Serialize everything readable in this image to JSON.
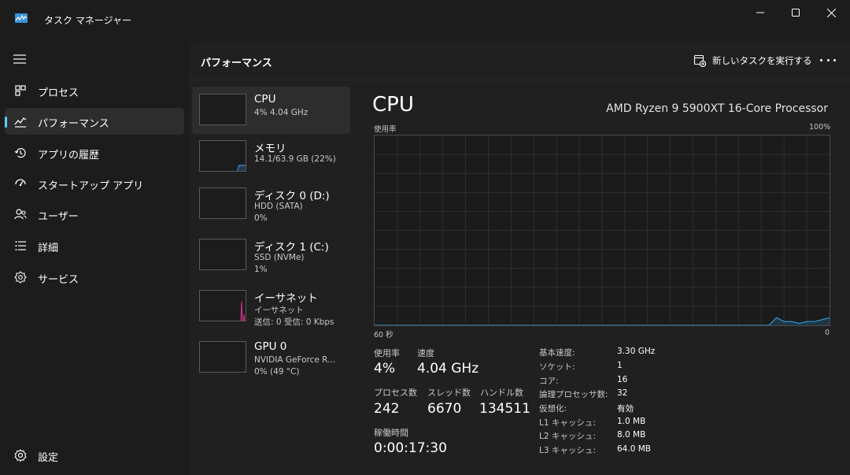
{
  "window": {
    "title": "タスク マネージャー"
  },
  "nav": {
    "items": [
      {
        "label": "プロセス",
        "icon": "processes-icon"
      },
      {
        "label": "パフォーマンス",
        "icon": "performance-icon"
      },
      {
        "label": "アプリの履歴",
        "icon": "history-icon"
      },
      {
        "label": "スタートアップ アプリ",
        "icon": "startup-icon"
      },
      {
        "label": "ユーザー",
        "icon": "users-icon"
      },
      {
        "label": "詳細",
        "icon": "details-icon"
      },
      {
        "label": "サービス",
        "icon": "services-icon"
      }
    ],
    "settings_label": "設定"
  },
  "header": {
    "title": "パフォーマンス",
    "run_task_label": "新しいタスクを実行する"
  },
  "devices": [
    {
      "name": "CPU",
      "sub1": "4%  4.04 GHz",
      "sub2": ""
    },
    {
      "name": "メモリ",
      "sub1": "14.1/63.9 GB (22%)",
      "sub2": ""
    },
    {
      "name": "ディスク 0 (D:)",
      "sub1": "HDD (SATA)",
      "sub2": "0%"
    },
    {
      "name": "ディスク 1 (C:)",
      "sub1": "SSD (NVMe)",
      "sub2": "1%"
    },
    {
      "name": "イーサネット",
      "sub1": "イーサネット",
      "sub2": "送信: 0 受信: 0 Kbps"
    },
    {
      "name": "GPU 0",
      "sub1": "NVIDIA GeForce R...",
      "sub2": "0%  (49 °C)"
    }
  ],
  "detail": {
    "title": "CPU",
    "model": "AMD Ryzen 9 5900XT 16-Core Processor",
    "graph_label_top_left": "使用率",
    "graph_label_top_right": "100%",
    "graph_label_bottom_left": "60 秒",
    "graph_label_bottom_right": "0",
    "stats": {
      "usage_label": "使用率",
      "usage_value": "4%",
      "speed_label": "速度",
      "speed_value": "4.04 GHz",
      "processes_label": "プロセス数",
      "processes_value": "242",
      "threads_label": "スレッド数",
      "threads_value": "6670",
      "handles_label": "ハンドル数",
      "handles_value": "134511",
      "uptime_label": "稼働時間",
      "uptime_value": "0:00:17:30"
    },
    "specs": [
      {
        "k": "基本速度:",
        "v": "3.30 GHz"
      },
      {
        "k": "ソケット:",
        "v": "1"
      },
      {
        "k": "コア:",
        "v": "16"
      },
      {
        "k": "論理プロセッサ数:",
        "v": "32"
      },
      {
        "k": "仮想化:",
        "v": "有効"
      },
      {
        "k": "L1 キャッシュ:",
        "v": "1.0 MB"
      },
      {
        "k": "L2 キャッシュ:",
        "v": "8.0 MB"
      },
      {
        "k": "L3 キャッシュ:",
        "v": "64.0 MB"
      }
    ]
  },
  "chart_data": {
    "type": "area",
    "x": [
      60,
      8,
      7,
      6,
      5,
      4,
      3,
      2,
      1,
      0
    ],
    "values": [
      0,
      0,
      4,
      2,
      2,
      1,
      2,
      2,
      3,
      4
    ],
    "ylim": [
      0,
      100
    ],
    "xlim": [
      60,
      0
    ],
    "grid": true
  },
  "colors": {
    "accent": "#60cdff",
    "cpu_line": "#2f9bd6",
    "memory_line": "#3f8fd8",
    "ethernet_line": "#d0338a",
    "gpu_line": "#3a7ed8"
  }
}
